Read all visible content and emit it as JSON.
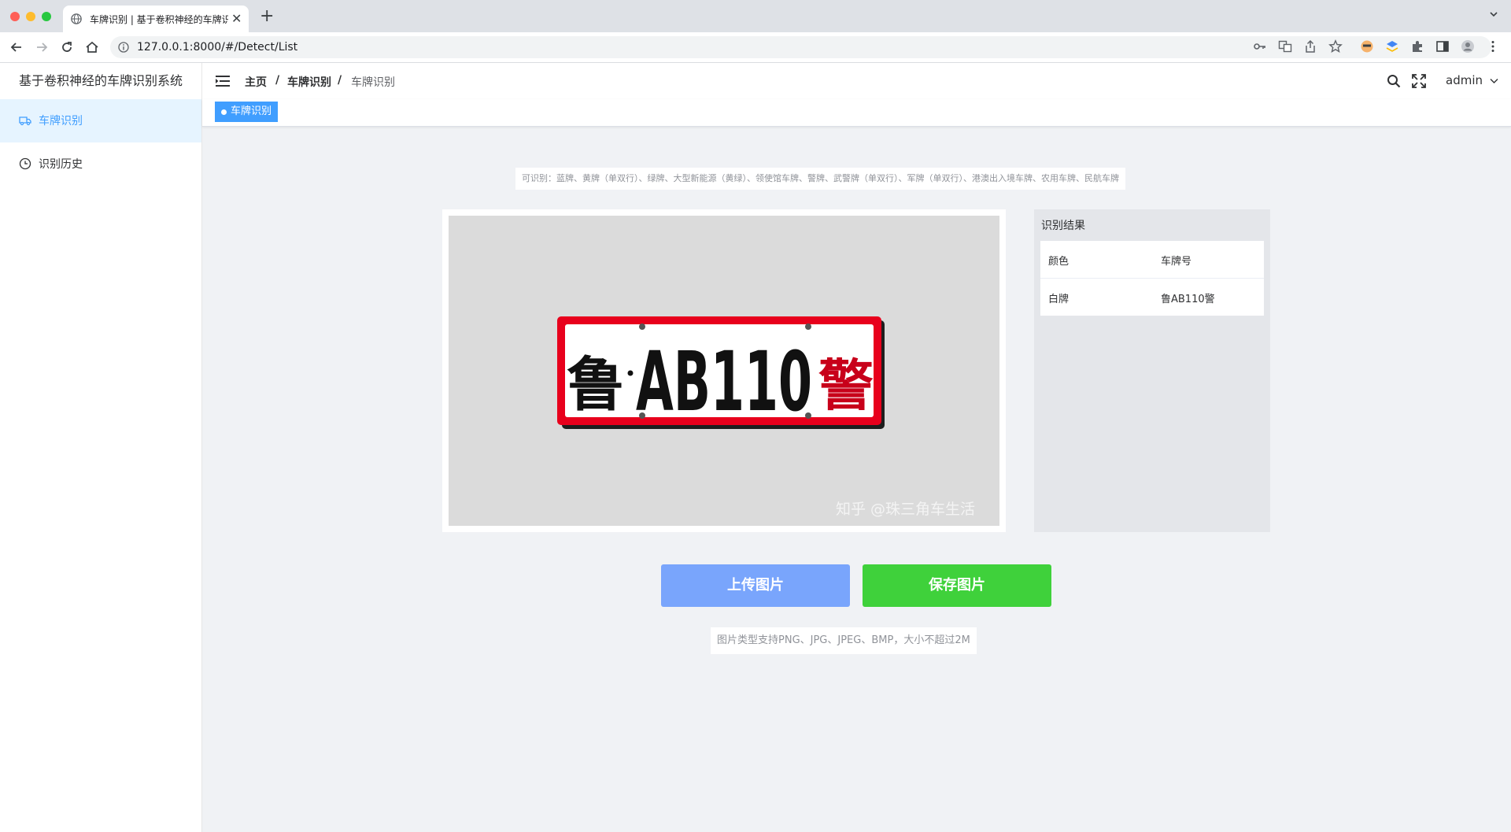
{
  "browser": {
    "tab_title": "车牌识别 | 基于卷积神经的车牌识",
    "url": "127.0.0.1:8000/#/Detect/List"
  },
  "sidebar": {
    "brand": "基于卷积神经的车牌识别系统",
    "items": [
      {
        "label": "车牌识别",
        "icon": "truck-icon",
        "active": true
      },
      {
        "label": "识别历史",
        "icon": "clock-icon",
        "active": false
      }
    ]
  },
  "header": {
    "breadcrumb": [
      "主页",
      "车牌识别",
      "车牌识别"
    ],
    "separator": "/",
    "user": "admin"
  },
  "tags": {
    "active_label": "车牌识别"
  },
  "main": {
    "supported_note": "可识别：蓝牌、黄牌（单双行）、绿牌、大型新能源（黄绿）、领使馆车牌、警牌、武警牌（单双行）、军牌（单双行）、港澳出入境车牌、农用车牌、民航车牌",
    "plate_image": {
      "province_char": "鲁",
      "plate_code": "AB110",
      "suffix_char": "警",
      "watermark": "知乎 @珠三角车生活"
    },
    "upload_button": "上传图片",
    "save_button": "保存图片",
    "file_tip": "图片类型支持PNG、JPG、JPEG、BMP，大小不超过2M"
  },
  "result": {
    "title": "识别结果",
    "columns": [
      "颜色",
      "车牌号"
    ],
    "rows": [
      {
        "color": "白牌",
        "plate": "鲁AB110警"
      }
    ]
  },
  "colors": {
    "primary": "#409eff",
    "upload_button": "#79a5fc",
    "save_button": "#3fd13b",
    "plate_border": "#e8001c"
  }
}
